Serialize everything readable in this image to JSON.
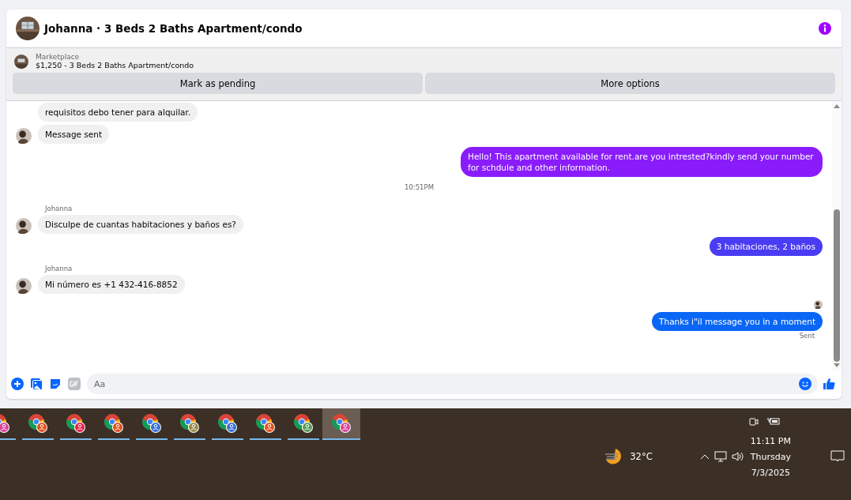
{
  "chat": {
    "title": "Johanna · 3 Beds 2 Baths Apartment/condo",
    "listing": {
      "source": "Marketplace",
      "summary": "$1,250 - 3 Beds 2 Baths Apartment/condo"
    },
    "actions": [
      "Mark as pending",
      "More options"
    ],
    "messages": [
      {
        "kind": "incoming",
        "text": "requisitos debo tener para alquilar.",
        "avatar": false
      },
      {
        "kind": "incoming",
        "text": "Message sent",
        "avatar": true
      },
      {
        "kind": "outgoing",
        "text": "Hello! This apartment available for rent.are you intrested?kindly send your number for schdule and other information.",
        "color": "#8a1cfc"
      },
      {
        "kind": "time",
        "text": "10:51PM"
      },
      {
        "kind": "incoming",
        "sender": "Johanna",
        "text": "Disculpe de cuantas habitaciones y baños es?",
        "avatar": true
      },
      {
        "kind": "outgoing",
        "text": "3 habitaciones, 2 baños",
        "color": "#4a3cf4"
      },
      {
        "kind": "incoming",
        "sender": "Johanna",
        "text": "Mi número es +1 432-416-8852",
        "avatar": true
      },
      {
        "kind": "seen"
      },
      {
        "kind": "outgoing",
        "text": "Thanks i\"il message you in a moment",
        "color": "#0a66f5"
      },
      {
        "kind": "status",
        "text": "Sent"
      }
    ],
    "composer": {
      "placeholder": "Aa"
    }
  },
  "taskbar": {
    "apps": [
      {
        "color": "#d9449a",
        "selected": false
      },
      {
        "color": "#e0501e",
        "selected": false
      },
      {
        "color": "#e3224a",
        "selected": false
      },
      {
        "color": "#e0501e",
        "selected": false
      },
      {
        "color": "#3a6fd8",
        "selected": false
      },
      {
        "color": "#9a8a4a",
        "selected": false
      },
      {
        "color": "#3a6fd8",
        "selected": false
      },
      {
        "color": "#e0501e",
        "selected": false
      },
      {
        "color": "#5a9a5a",
        "selected": false
      },
      {
        "color": "#d9449a",
        "selected": true
      }
    ],
    "weather": "32°C",
    "time": "11:11 PM",
    "day": "Thursday",
    "date": "7/3/2025"
  }
}
